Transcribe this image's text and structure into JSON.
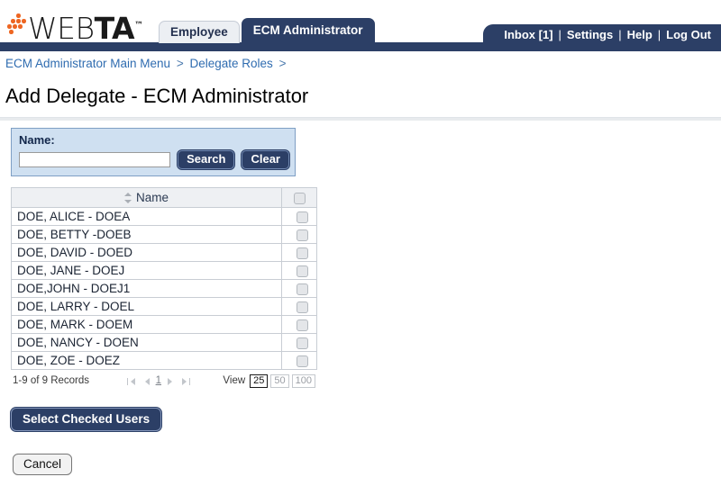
{
  "header": {
    "logo": {
      "text_light": "WEB",
      "text_bold": "TA",
      "trademark": "™"
    },
    "tabs": [
      {
        "label": "Employee",
        "active": false
      },
      {
        "label": "ECM Administrator",
        "active": true
      }
    ],
    "nav": [
      {
        "label": "Inbox [1]"
      },
      {
        "label": "Settings"
      },
      {
        "label": "Help"
      },
      {
        "label": "Log Out"
      }
    ],
    "nav_separator": "|"
  },
  "breadcrumb": {
    "items": [
      {
        "label": "ECM Administrator Main Menu"
      },
      {
        "label": "Delegate Roles"
      }
    ],
    "separator": ">"
  },
  "page": {
    "title": "Add Delegate - ECM Administrator"
  },
  "search": {
    "label": "Name:",
    "input_value": "",
    "input_placeholder": "",
    "search_button": "Search",
    "clear_button": "Clear"
  },
  "table": {
    "columns": [
      {
        "key": "name",
        "label": "Name",
        "sortable": true
      },
      {
        "key": "select",
        "label": "",
        "sortable": false
      }
    ],
    "header_select_all_checked": false,
    "rows": [
      {
        "name": "DOE, ALICE - DOEA",
        "checked": false
      },
      {
        "name": "DOE, BETTY -DOEB",
        "checked": false
      },
      {
        "name": "DOE, DAVID - DOED",
        "checked": false
      },
      {
        "name": "DOE, JANE - DOEJ",
        "checked": false
      },
      {
        "name": "DOE,JOHN - DOEJ1",
        "checked": false
      },
      {
        "name": "DOE, LARRY - DOEL",
        "checked": false
      },
      {
        "name": "DOE, MARK - DOEM",
        "checked": false
      },
      {
        "name": "DOE, NANCY - DOEN",
        "checked": false
      },
      {
        "name": "DOE, ZOE - DOEZ",
        "checked": false
      }
    ]
  },
  "pagination": {
    "records_text": "1-9 of 9 Records",
    "current_page": "1",
    "view_label": "View",
    "page_size_options": [
      {
        "label": "25",
        "active": true
      },
      {
        "label": "50",
        "active": false
      },
      {
        "label": "100",
        "active": false
      }
    ]
  },
  "actions": {
    "select_checked_users": "Select Checked Users",
    "cancel": "Cancel"
  },
  "colors": {
    "navy": "#2c3f66",
    "link_blue": "#2f6cb0",
    "panel_blue": "#cfe0f1",
    "logo_orange": "#ee6622"
  }
}
